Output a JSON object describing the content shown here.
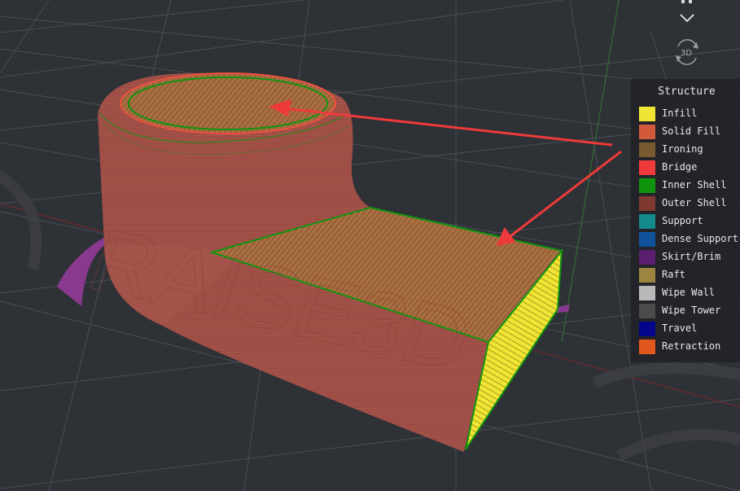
{
  "view_controls": {
    "view_3d_label": "3D",
    "icons": [
      "camera-view-icon",
      "chevron-down-icon",
      "rotate-3d-icon"
    ]
  },
  "legend": {
    "title": "Structure",
    "items": [
      {
        "label": "Infill",
        "color": "#f0e532"
      },
      {
        "label": "Solid Fill",
        "color": "#d2593c"
      },
      {
        "label": "Ironing",
        "color": "#7a5a30"
      },
      {
        "label": "Bridge",
        "color": "#ee3a3a"
      },
      {
        "label": "Inner Shell",
        "color": "#109410"
      },
      {
        "label": "Outer Shell",
        "color": "#7e3a30"
      },
      {
        "label": "Support",
        "color": "#158a8c"
      },
      {
        "label": "Dense Support",
        "color": "#10539a"
      },
      {
        "label": "Skirt/Brim",
        "color": "#5a1f6e"
      },
      {
        "label": "Raft",
        "color": "#9b8540"
      },
      {
        "label": "Wipe Wall",
        "color": "#b9b9b9"
      },
      {
        "label": "Wipe Tower",
        "color": "#4c4c4c"
      },
      {
        "label": "Travel",
        "color": "#05058c"
      },
      {
        "label": "Retraction",
        "color": "#e2571c"
      }
    ]
  },
  "model": {
    "embossed_text": "RAISE3D",
    "colors": {
      "outer_shell": "#a4534a",
      "top_solid": "#a9703f",
      "inner_shell": "#109410",
      "infill": "#f0e532",
      "skirt": "#8a3a8e",
      "annotation_arrow": "#ee3a3a"
    }
  }
}
